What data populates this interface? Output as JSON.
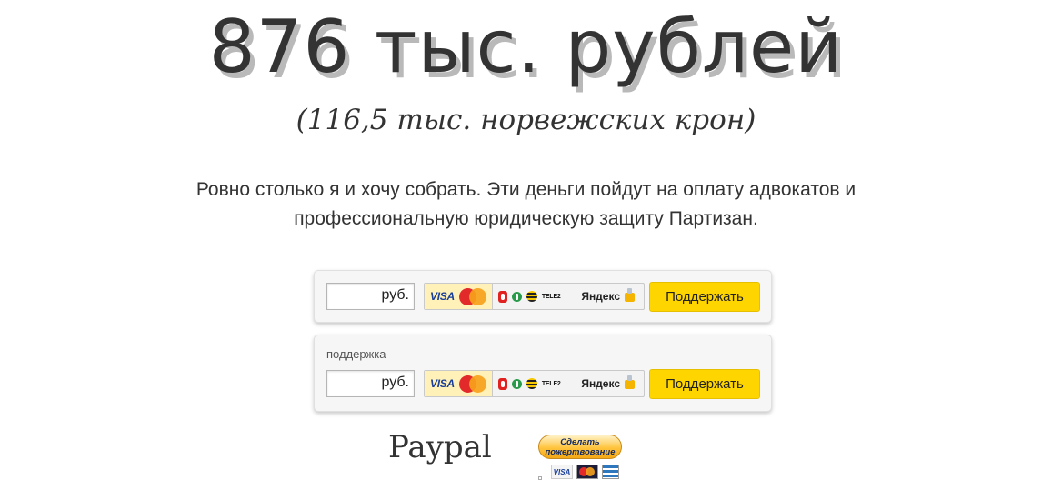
{
  "headline": "876 тыс. рублей",
  "subheadline": "(116,5 тыс. норвежских крон)",
  "intro_text": "Ровно столько я и хочу собрать. Эти деньги пойдут на оплату адвокатов и профессиональную юридическую защиту Партизан.",
  "widgets": [
    {
      "title": "",
      "amount_value": "",
      "currency": "руб.",
      "methods": {
        "cards": {
          "visa": "VISA",
          "icon": "mastercard-icon"
        },
        "mobile": {
          "tele2": "TELE2",
          "icons": [
            "mts-icon",
            "megafon-icon",
            "beeline-icon"
          ]
        },
        "yandex": {
          "label": "Яндекс",
          "icon": "wallet-icon"
        }
      },
      "submit_label": "Поддержать"
    },
    {
      "title": "поддержка",
      "amount_value": "",
      "currency": "руб.",
      "methods": {
        "cards": {
          "visa": "VISA",
          "icon": "mastercard-icon"
        },
        "mobile": {
          "tele2": "TELE2",
          "icons": [
            "mts-icon",
            "megafon-icon",
            "beeline-icon"
          ]
        },
        "yandex": {
          "label": "Яндекс",
          "icon": "wallet-icon"
        }
      },
      "submit_label": "Поддержать"
    }
  ],
  "paypal": {
    "label": "Paypal",
    "donate_button": {
      "line1": "Сделать",
      "line2": "пожертвование"
    },
    "cards": {
      "visa": "VISA",
      "icons": [
        "mastercard-icon",
        "amex-icon"
      ]
    }
  },
  "colors": {
    "text": "#333333",
    "button_yellow": "#ffd500",
    "selected_method_bg": "#fff1b8",
    "widget_bg": "#f6f6f6"
  }
}
